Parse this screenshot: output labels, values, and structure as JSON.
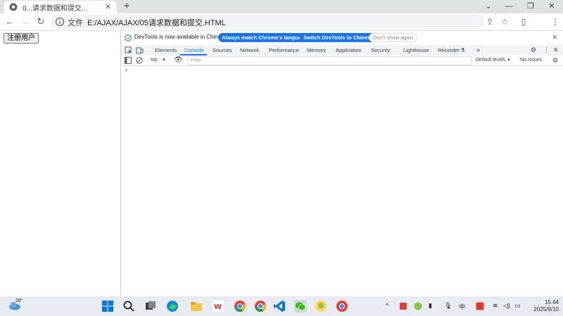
{
  "browser": {
    "tab_title": "0...请求数据和提交...",
    "new_tab_symbol": "+",
    "scheme_label": "文件",
    "url": "E:/AJAX/AJAX/05请求数据和提交.HTML"
  },
  "page": {
    "register_button": "注册用户"
  },
  "devtools": {
    "infobar_message": "DevTools is now available in Chinese!",
    "match_language": "Always match Chrome's language",
    "switch_chinese": "Switch DevTools to Chinese",
    "dont_show": "Don't show again",
    "tabs": [
      "Elements",
      "Console",
      "Sources",
      "Network",
      "Performance",
      "Memory",
      "Application",
      "Security",
      "Lighthouse",
      "Recorder"
    ],
    "active_tab": "Console",
    "more_tabs": "»",
    "context": "top",
    "filter_placeholder": "Filter",
    "levels": "Default levels",
    "issues": "No Issues",
    "prompt": "›"
  },
  "taskbar": {
    "weather_temp": "28°",
    "ime": "中",
    "time": "15:44",
    "date": "2025/9/10"
  },
  "colors": {
    "accent": "#1a73e8",
    "taskbar_bg": "#e8ecf2"
  }
}
